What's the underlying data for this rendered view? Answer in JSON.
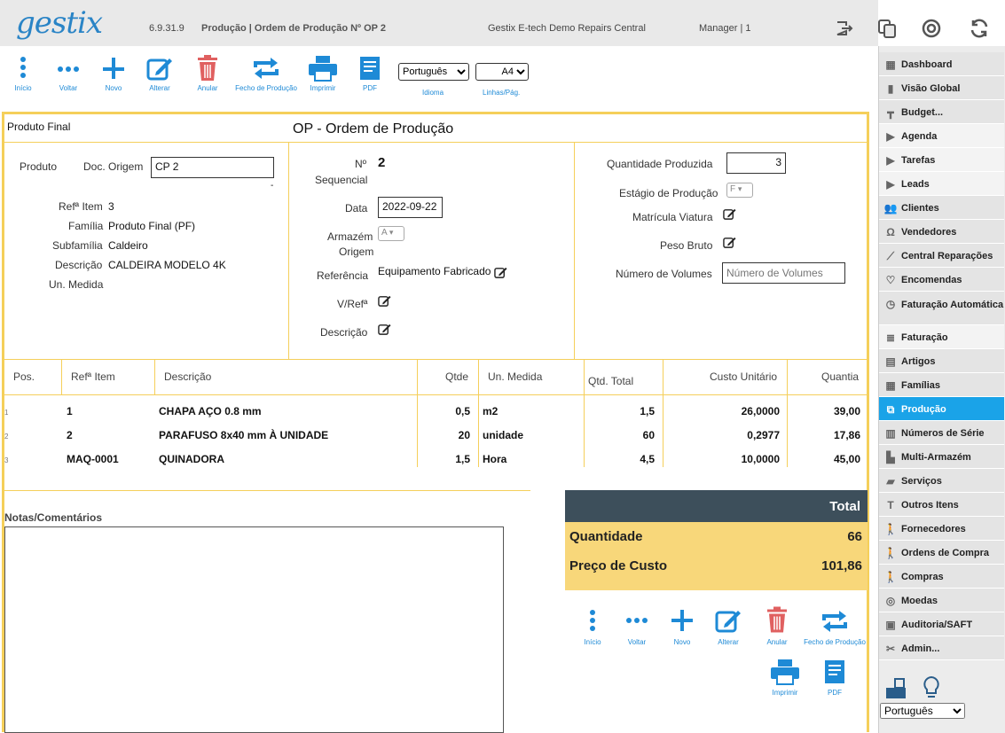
{
  "header": {
    "logo": "gestix",
    "version": "6.9.31.9",
    "title": "Produção | Ordem de Produção Nº OP 2",
    "company": "Gestix E-tech Demo Repairs Central",
    "user": "Manager | 1"
  },
  "toolbar": {
    "inicio": "Início",
    "voltar": "Voltar",
    "novo": "Novo",
    "alterar": "Alterar",
    "anular": "Anular",
    "fecho": "Fecho de Produção",
    "imprimir": "Imprimir",
    "pdf": "PDF",
    "idioma_value": "Português",
    "idioma_label": "Idioma",
    "linhas_value": "A4",
    "linhas_label": "Linhas/Pág."
  },
  "doc": {
    "section_label": "Produto Final",
    "title": "OP - Ordem de Produção"
  },
  "produto": {
    "produto_label": "Produto",
    "doc_origem_label": "Doc. Origem",
    "doc_origem_value": "CP 2",
    "dash": "-",
    "ref_label": "Refª Item",
    "ref_value": "3",
    "familia_label": "Família",
    "familia_value": "Produto Final (PF)",
    "subfamilia_label": "Subfamília",
    "subfamilia_value": "Caldeiro",
    "descricao_label": "Descrição",
    "descricao_value": "CALDEIRA MODELO 4K",
    "unmedida_label": "Un. Medida"
  },
  "middle": {
    "nseq_label1": "Nº",
    "nseq_label2": "Sequencial",
    "nseq_value": "2",
    "data_label": "Data",
    "data_value": "2022-09-22",
    "armazem_label1": "Armazém",
    "armazem_label2": "Origem",
    "armazem_value": "A",
    "referencia_label": "Referência",
    "referencia_value": "Equipamento Fabricado",
    "vref_label": "V/Refª",
    "descricao_label": "Descrição"
  },
  "right": {
    "qtd_label": "Quantidade Produzida",
    "qtd_value": "3",
    "estagio_label": "Estágio de Produção",
    "estagio_value": "F",
    "matricula_label": "Matrícula Viatura",
    "peso_label": "Peso Bruto",
    "volumes_label": "Número de Volumes",
    "volumes_placeholder": "Número de Volumes"
  },
  "table": {
    "headers": [
      "Pos.",
      "Refª Item",
      "Descrição",
      "Qtde",
      "Un. Medida",
      "Qtd. Total",
      "Custo Unitário",
      "Quantia"
    ],
    "rows": [
      {
        "pos": "1",
        "ref": "1",
        "desc": "CHAPA AÇO 0.8 mm",
        "qtde": "0,5",
        "un": "m2",
        "total": "1,5",
        "custo": "26,0000",
        "quantia": "39,00"
      },
      {
        "pos": "2",
        "ref": "2",
        "desc": "PARAFUSO 8x40 mm À UNIDADE",
        "qtde": "20",
        "un": "unidade",
        "total": "60",
        "custo": "0,2977",
        "quantia": "17,86"
      },
      {
        "pos": "3",
        "ref": "MAQ-0001",
        "desc": "QUINADORA",
        "qtde": "1,5",
        "un": "Hora",
        "total": "4,5",
        "custo": "10,0000",
        "quantia": "45,00"
      }
    ]
  },
  "notes": {
    "label": "Notas/Comentários"
  },
  "totals": {
    "header": "Total",
    "quantidade_label": "Quantidade",
    "quantidade_value": "66",
    "preco_label": "Preço de Custo",
    "preco_value": "101,86"
  },
  "sidebar": {
    "items": [
      {
        "label": "Dashboard",
        "icon": "chart-icon"
      },
      {
        "label": "Visão Global",
        "icon": "bars-icon"
      },
      {
        "label": "Budget...",
        "icon": "hierarchy-icon"
      },
      {
        "label": "Agenda",
        "icon": "triangle-icon"
      },
      {
        "label": "Tarefas",
        "icon": "triangle-icon"
      },
      {
        "label": "Leads",
        "icon": "triangle-icon"
      },
      {
        "label": "Clientes",
        "icon": "users-icon"
      },
      {
        "label": "Vendedores",
        "icon": "headset-icon"
      },
      {
        "label": "Central Reparações",
        "icon": "wrench-icon"
      },
      {
        "label": "Encomendas",
        "icon": "heart-icon"
      },
      {
        "label": "Faturação Automática",
        "icon": "timer-icon"
      },
      {
        "label": "Faturação",
        "icon": "doc-icon"
      },
      {
        "label": "Artigos",
        "icon": "boxes-icon"
      },
      {
        "label": "Famílias",
        "icon": "grid-icon"
      },
      {
        "label": "Produção",
        "icon": "production-icon"
      },
      {
        "label": "Números de Série",
        "icon": "barcode-icon"
      },
      {
        "label": "Multi-Armazém",
        "icon": "warehouse-icon"
      },
      {
        "label": "Serviços",
        "icon": "briefcase-icon"
      },
      {
        "label": "Outros Itens",
        "icon": "text-plus-icon"
      },
      {
        "label": "Fornecedores",
        "icon": "walker-icon"
      },
      {
        "label": "Ordens de Compra",
        "icon": "walker-icon"
      },
      {
        "label": "Compras",
        "icon": "walker-icon"
      },
      {
        "label": "Moedas",
        "icon": "coins-icon"
      },
      {
        "label": "Auditoria/SAFT",
        "icon": "audit-icon"
      },
      {
        "label": "Admin...",
        "icon": "tools-icon"
      }
    ],
    "language": "Português"
  },
  "colors": {
    "brand": "#2a84c6",
    "accent": "#1aa3e8",
    "frame": "#f5cf5a",
    "totals_bg": "#f8d77a",
    "totals_head": "#3d4f5b",
    "anular": "#e06060"
  }
}
